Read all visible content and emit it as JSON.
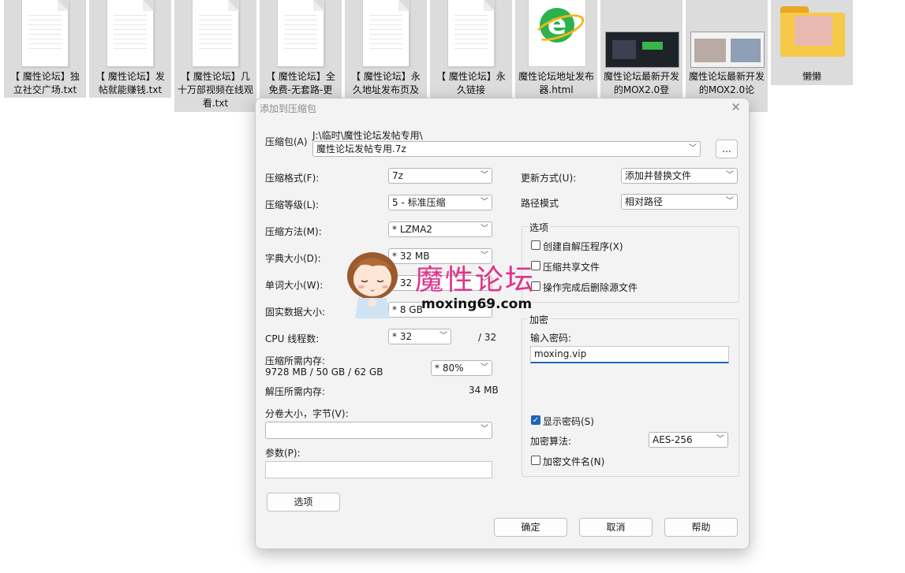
{
  "desktop": {
    "files": [
      {
        "name": "【 魔性论坛】独立社交广场.txt"
      },
      {
        "name": "【 魔性论坛】发帖就能赚钱.txt"
      },
      {
        "name": "【 魔性论坛】几十万部视频在线观看.txt"
      },
      {
        "name": "【 魔性论坛】全免费-无套路-更"
      },
      {
        "name": "【 魔性论坛】永久地址发布页及"
      },
      {
        "name": "【 魔性论坛】永久链接"
      },
      {
        "name": "魔性论坛地址发布器.html"
      },
      {
        "name": "魔性论坛最新开发的MOX2.0登"
      },
      {
        "name": "魔性论坛最新开发的MOX2.0论"
      },
      {
        "name": "懒懒"
      }
    ]
  },
  "dialog": {
    "title": "添加到压缩包",
    "archive": {
      "label": "压缩包(A)",
      "path": "J:\\临时\\魔性论坛发帖专用\\",
      "name": "魔性论坛发帖专用.7z",
      "browse": "..."
    },
    "format": {
      "label": "压缩格式(F):",
      "value": "7z"
    },
    "level": {
      "label": "压缩等级(L):",
      "value": "5 - 标准压缩"
    },
    "method": {
      "label": "压缩方法(M):",
      "value": "* LZMA2"
    },
    "dict": {
      "label": "字典大小(D):",
      "value": "* 32 MB"
    },
    "word": {
      "label": "单词大小(W):",
      "value": "* 32"
    },
    "solid": {
      "label": "固实数据大小:",
      "value": "* 8 GB"
    },
    "threads": {
      "label": "CPU 线程数:",
      "value": "* 32",
      "max": "/ 32"
    },
    "mem_compress": {
      "label": "压缩所需内存:",
      "detail": "9728 MB / 50 GB / 62 GB",
      "value": "* 80%"
    },
    "mem_decompress": {
      "label": "解压所需内存:",
      "value": "34 MB"
    },
    "volume": {
      "label": "分卷大小，字节(V):",
      "value": ""
    },
    "params": {
      "label": "参数(P):",
      "value": ""
    },
    "options_button": "选项",
    "update": {
      "label": "更新方式(U):",
      "value": "添加并替换文件"
    },
    "path_mode": {
      "label": "路径模式",
      "value": "相对路径"
    },
    "options": {
      "title": "选项",
      "sfx": "创建自解压程序(X)",
      "shared": "压缩共享文件",
      "delete": "操作完成后删除源文件"
    },
    "encryption": {
      "title": "加密",
      "password_label": "输入密码:",
      "password": "moxing.vip",
      "show_password": "显示密码(S)",
      "method_label": "加密算法:",
      "method": "AES-256",
      "encrypt_names": "加密文件名(N)"
    },
    "ok": "确定",
    "cancel": "取消",
    "help": "帮助"
  },
  "watermark": {
    "text": "魔性论坛",
    "url": "moxing69.com"
  }
}
